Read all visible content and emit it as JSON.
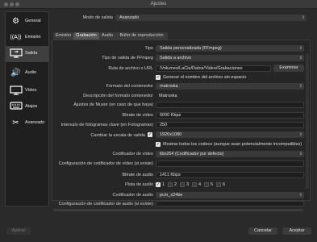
{
  "window": {
    "title": "Ajustes"
  },
  "sidebar": {
    "items": [
      {
        "label": "General",
        "icon": "gear-icon"
      },
      {
        "label": "Emisión",
        "icon": "broadcast-icon"
      },
      {
        "label": "Salida",
        "icon": "output-icon",
        "active": true
      },
      {
        "label": "Audio",
        "icon": "speaker-icon"
      },
      {
        "label": "Vídeo",
        "icon": "monitor-icon"
      },
      {
        "label": "Atajos",
        "icon": "keyboard-icon"
      },
      {
        "label": "Avanzado",
        "icon": "tools-icon"
      }
    ]
  },
  "output_mode": {
    "label": "Modo de salida",
    "value": "Avanzado"
  },
  "tabs": [
    {
      "label": "Emisión"
    },
    {
      "label": "Grabación",
      "active": true
    },
    {
      "label": "Audio"
    },
    {
      "label": "Búfer de reproducción"
    }
  ],
  "recording": {
    "type": {
      "label": "Tipo",
      "value": "Salida personalizada (FFmpeg)"
    },
    "ffmpeg_output_type": {
      "label": "Tipo de salida de FFmpeg",
      "value": "Salida a archivo"
    },
    "path": {
      "label": "Ruta de archivo o URL",
      "value": "/Volumes/LaCie/Datos/Video/Grabaciones",
      "browse": "Examinar"
    },
    "gen_name": {
      "label": "Generar el nombre del archivo sin espacio",
      "checked": true
    },
    "container_format": {
      "label": "Formato del contenedor",
      "value": "matroska"
    },
    "container_desc": {
      "label": "Descripción del formato contenedor",
      "value": "Matroska"
    },
    "muxer_settings": {
      "label": "Ajustes de Muxer (en caso de que haya)",
      "value": ""
    },
    "video_bitrate": {
      "label": "Bitrate de vídeo",
      "value": "6000 Kbps"
    },
    "keyframe_interval": {
      "label": "Intervalo de fotogramas clave (en Fotogramas)",
      "value": "250"
    },
    "rescale": {
      "label": "Cambiar la escala de salida",
      "checked": true,
      "value": "1920x1080"
    },
    "show_all_codecs": {
      "label": "Mostrar todos los codecs (aunque sean potencialmente incompatibles)",
      "checked": true
    },
    "video_encoder": {
      "label": "Codificador de vídeo",
      "value": "libx264 (Codificador por defecto)"
    },
    "video_encoder_config": {
      "label": "Configuración de codificador de vídeo (si existe)",
      "value": ""
    },
    "audio_bitrate": {
      "label": "Bitrate de audio",
      "value": "1411 Kbps"
    },
    "audio_track": {
      "label": "Pista de audio",
      "tracks": [
        "1",
        "2",
        "3",
        "4",
        "5",
        "6"
      ],
      "checked_index": 0
    },
    "audio_encoder": {
      "label": "Codificador de audio",
      "value": "pcm_s24be"
    },
    "audio_encoder_config": {
      "label": "Configuración de codificador de audio (si existe)",
      "value": ""
    }
  },
  "footer": {
    "apply": "Aplicar",
    "cancel": "Cancelar",
    "accept": "Aceptar"
  }
}
